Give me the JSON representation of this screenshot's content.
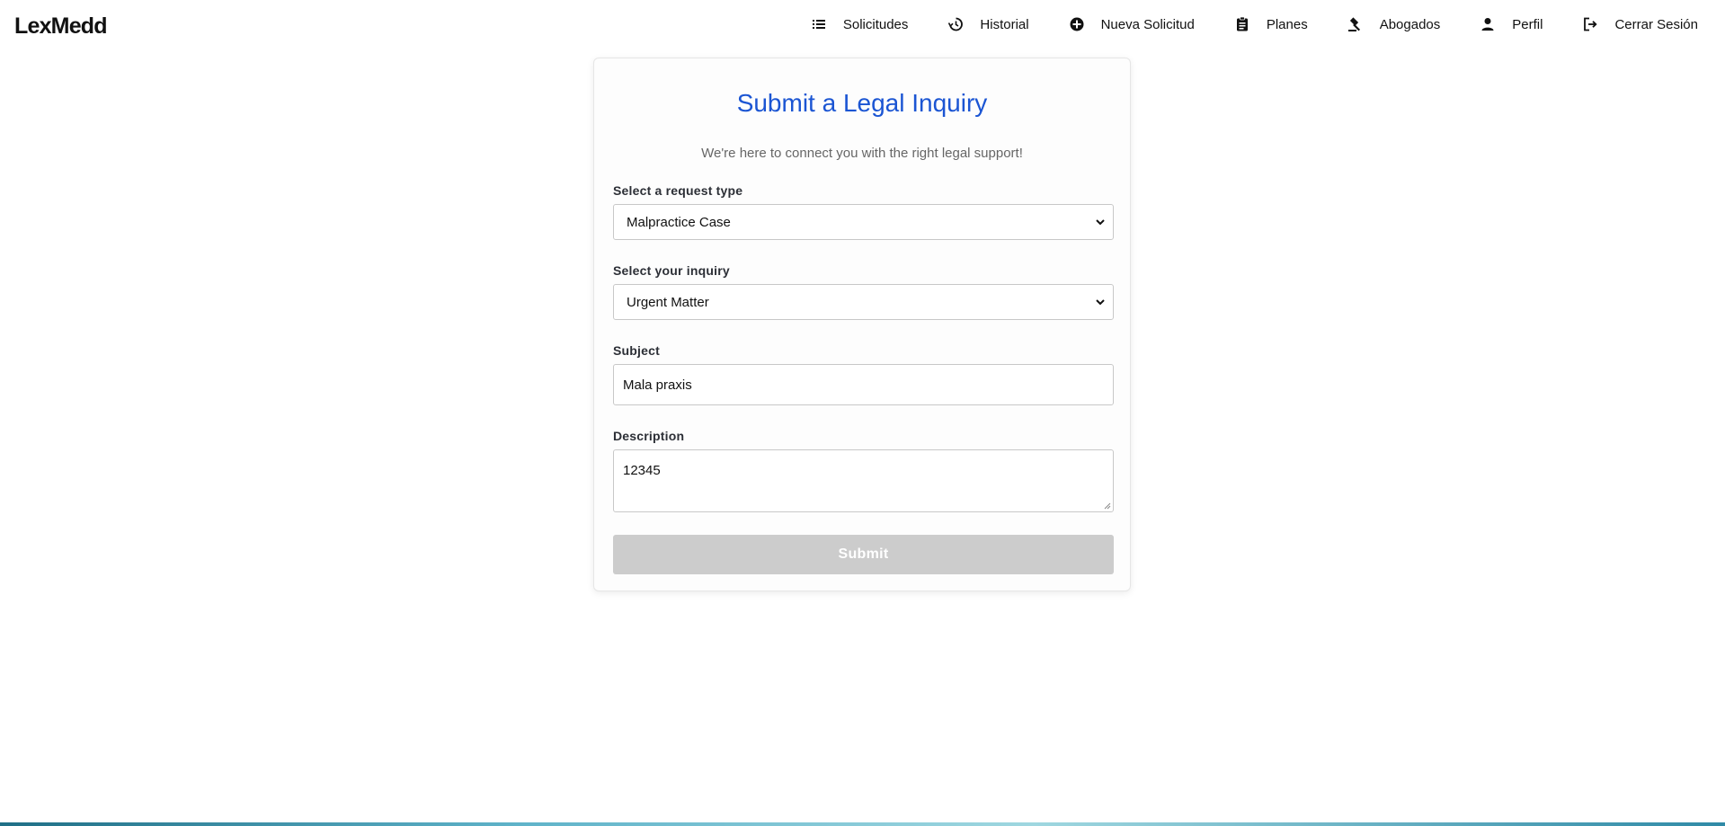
{
  "brand": {
    "name": "LexMedd"
  },
  "nav": {
    "items": [
      {
        "label": "Solicitudes",
        "icon": "list-icon"
      },
      {
        "label": "Historial",
        "icon": "history-icon"
      },
      {
        "label": "Nueva Solicitud",
        "icon": "add-circle-icon"
      },
      {
        "label": "Planes",
        "icon": "clipboard-icon"
      },
      {
        "label": "Abogados",
        "icon": "gavel-icon"
      },
      {
        "label": "Perfil",
        "icon": "person-icon"
      },
      {
        "label": "Cerrar Sesión",
        "icon": "logout-icon"
      }
    ]
  },
  "form": {
    "title": "Submit a Legal Inquiry",
    "subtitle": "We're here to connect you with the right legal support!",
    "request_type": {
      "label": "Select a request type",
      "value": "Malpractice Case"
    },
    "inquiry": {
      "label": "Select your inquiry",
      "value": "Urgent Matter"
    },
    "subject": {
      "label": "Subject",
      "value": "Mala praxis"
    },
    "description": {
      "label": "Description",
      "value": "12345"
    },
    "submit_label": "Submit"
  },
  "colors": {
    "title_accent": "#1b55d3",
    "submit_disabled": "#cccccc"
  }
}
